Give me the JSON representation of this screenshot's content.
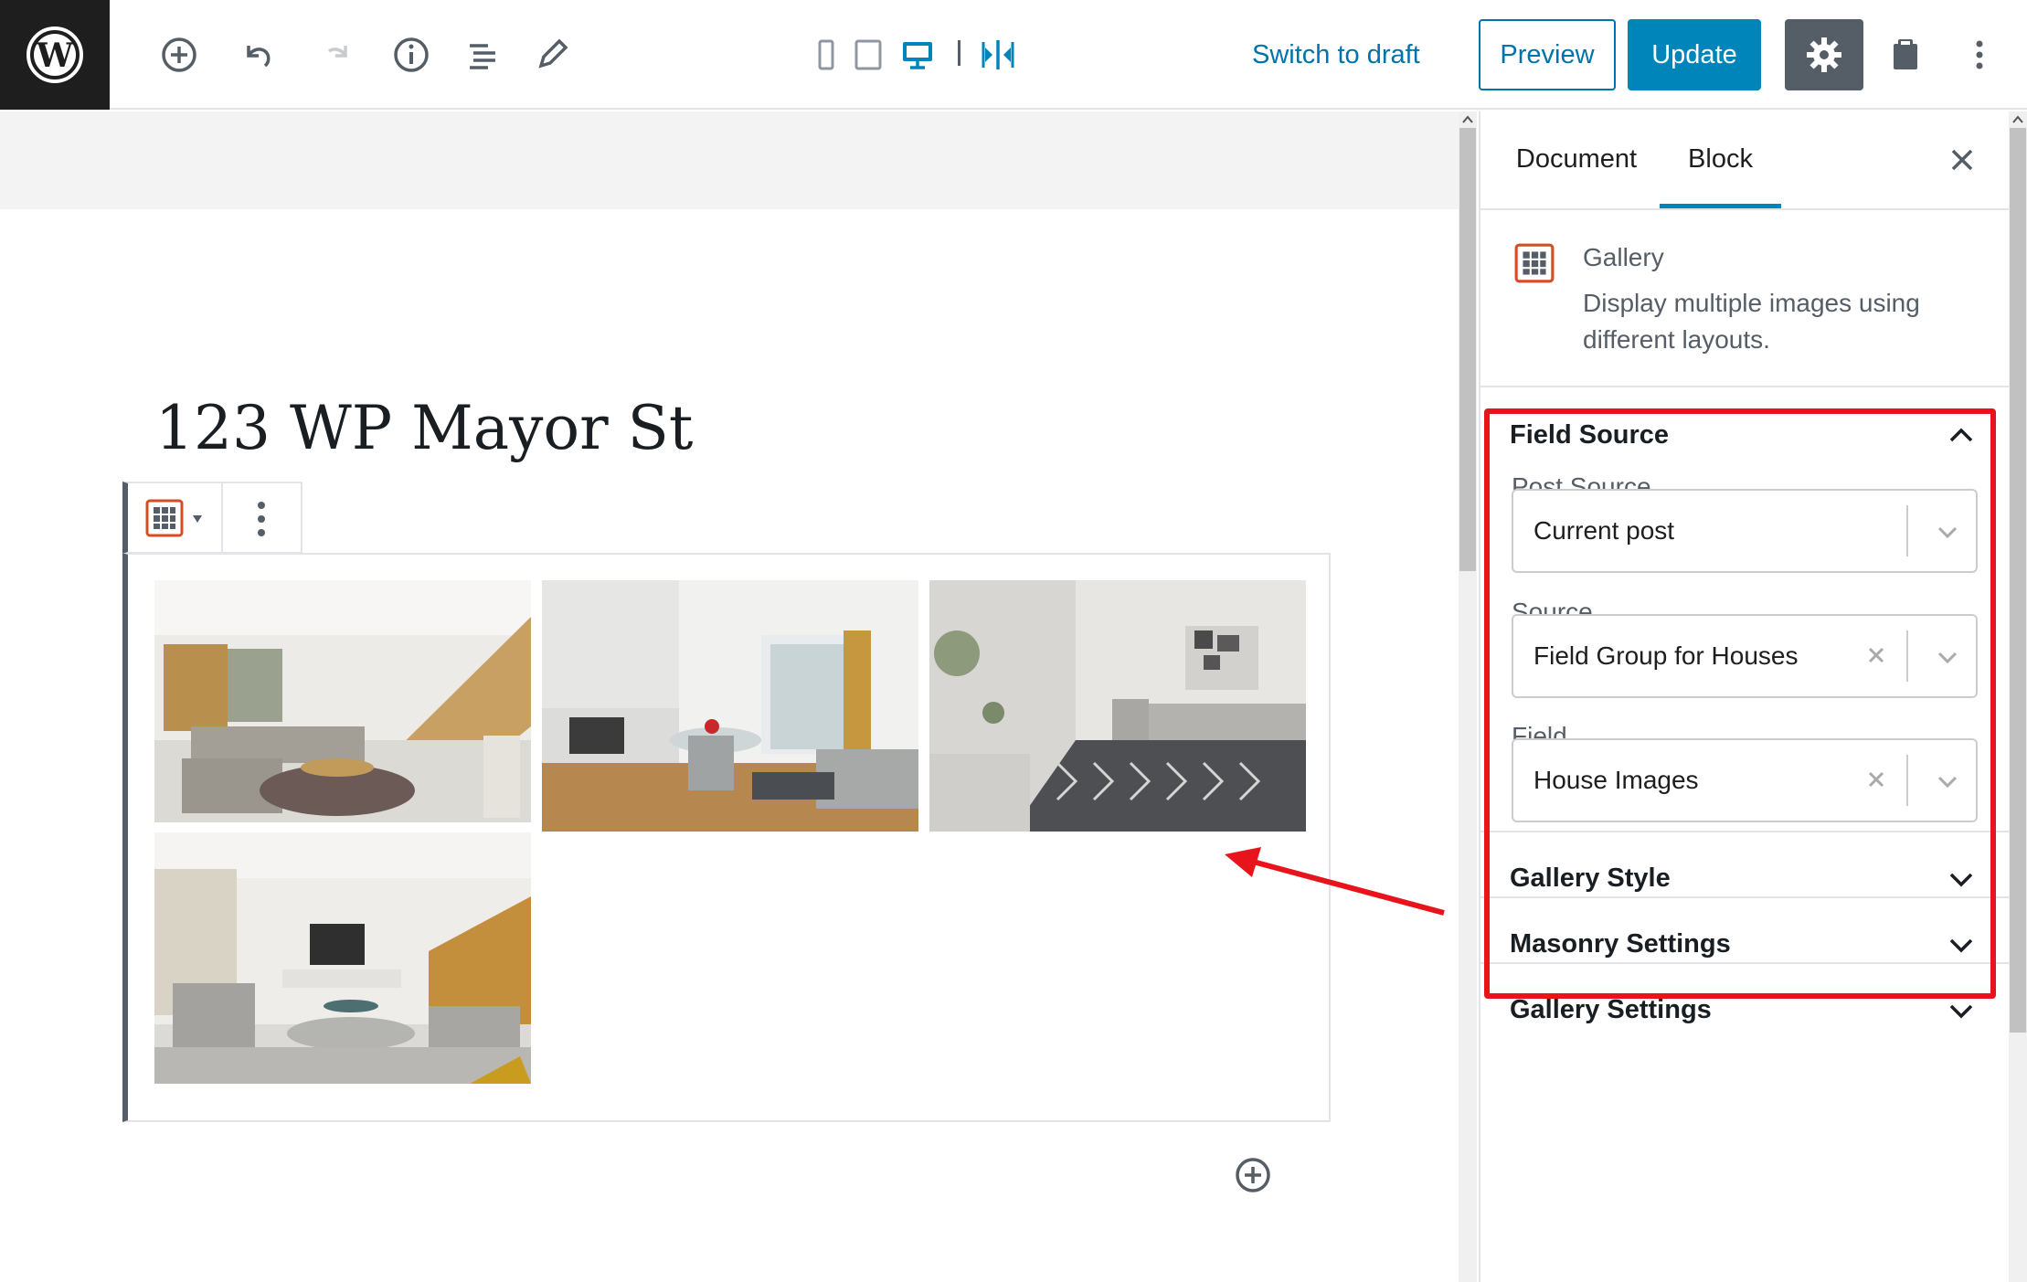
{
  "topbar": {
    "switch_to_draft": "Switch to draft",
    "preview": "Preview",
    "update": "Update",
    "icons": [
      "wordpress-logo-icon",
      "add-block-icon",
      "undo-icon",
      "redo-icon",
      "info-icon",
      "block-navigation-icon",
      "edit-pencil-icon",
      "mobile-preview-icon",
      "tablet-preview-icon",
      "desktop-preview-icon",
      "split-view-icon",
      "settings-gear-icon",
      "plugin-clipboard-icon",
      "more-options-icon"
    ]
  },
  "editor": {
    "post_title": "123 WP Mayor St"
  },
  "sidebar": {
    "tabs": [
      {
        "label": "Document"
      },
      {
        "label": "Block"
      }
    ],
    "active_tab": "Block",
    "block_card": {
      "name": "Gallery",
      "description_line1": "Display multiple images using",
      "description_line2": "different layouts."
    },
    "field_source": {
      "title": "Field Source",
      "post_source_label": "Post Source",
      "post_source_value": "Current post",
      "source_label": "Source",
      "source_value": "Field Group for Houses",
      "field_label": "Field",
      "field_value": "House Images"
    },
    "panels": [
      {
        "title": "Gallery Style"
      },
      {
        "title": "Masonry Settings"
      },
      {
        "title": "Gallery Settings"
      }
    ]
  },
  "colors": {
    "accent_blue": "#0085ba",
    "link_blue": "#0073aa",
    "highlight_red": "#e8141b",
    "block_icon_orange": "#d54e21"
  }
}
